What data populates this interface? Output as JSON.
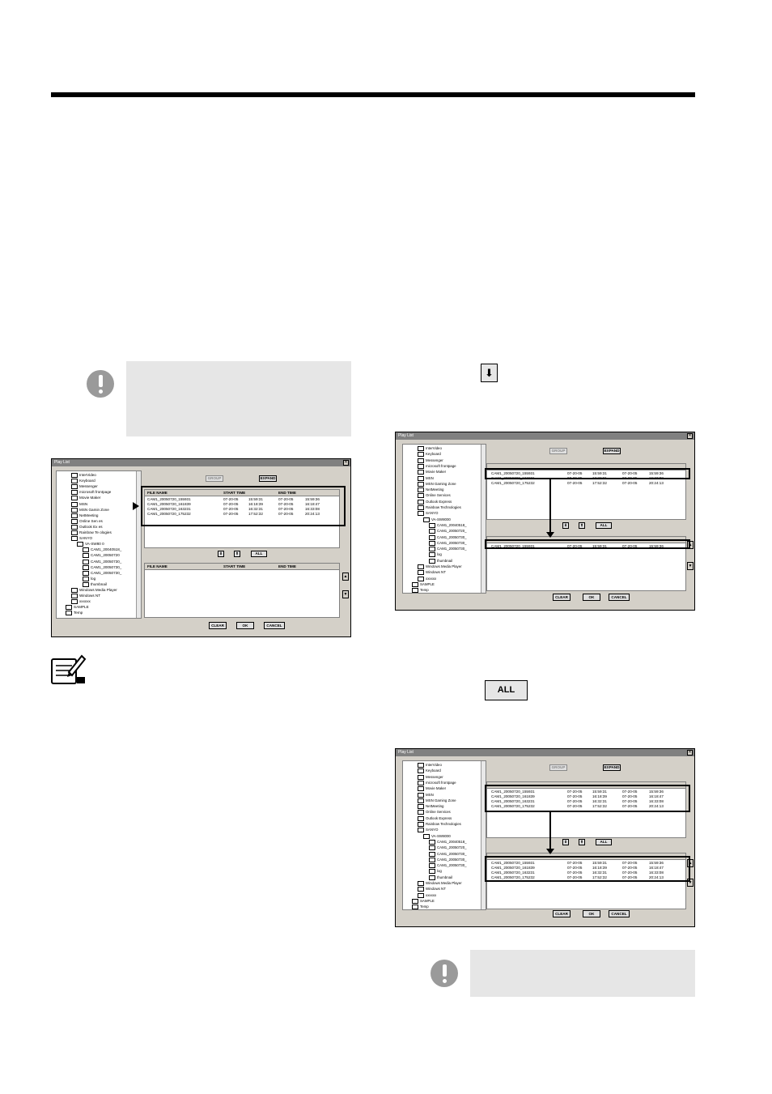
{
  "dialog": {
    "title": "Play List",
    "close_glyph": "✕",
    "group_label": "GROUP",
    "expand_label": "EXPAND",
    "down_glyph": "⬇",
    "up_glyph": "⬆",
    "all_label": "ALL",
    "clear_label": "CLEAR",
    "ok_label": "OK",
    "cancel_label": "CANCEL",
    "scroll_up_glyph": "▲",
    "scroll_down_glyph": "▼",
    "columns": [
      "FILE NAME",
      "START TIME",
      "END TIME"
    ]
  },
  "tree": {
    "items": [
      "InterVideo",
      "Keyboard",
      "Messenger",
      "microsoft frontpage",
      "Movie Maker",
      "MSN",
      "MSN Gaming Zone",
      "NetMeeting",
      "Online Services",
      "Outlook Express",
      "Rainbow Technologies",
      "SANYO",
      "VA-SW8000",
      "CAM1_20040518_",
      "CAM1_20050720_",
      "CAM1_20050730_",
      "CAM1_20050730_",
      "CAM1_20050730_",
      "log",
      "thumbnail",
      "Windows Media Player",
      "Windows NT",
      "xxxxxx",
      "SAMPLE",
      "Temp"
    ],
    "fig1_items": [
      "InterVideo",
      "Keyboard",
      "Messenger",
      "microsoft frontpage",
      "Movie Maker",
      "MSN",
      "MSN Gamin Zone",
      "NetMeeting",
      "Online Sen es",
      "Outlook Ex es",
      "Rainbow Te ologies",
      "SANYO",
      "VA-SW80 0",
      "CAM1_20040518_",
      "CAM1_20050720",
      "CAM1_20050730_",
      "CAM1_20050730_",
      "CAM1_20050730_",
      "log",
      "thumbnail",
      "Windows Media Player",
      "Windows NT",
      "xxxxxx",
      "SAMPLE",
      "Temp"
    ]
  },
  "files": [
    {
      "name": "CAM1_20050720_155931",
      "start_date": "07-20-05",
      "start_time": "15:59:31",
      "end_date": "07-20-05",
      "end_time": "15:59:36"
    },
    {
      "name": "CAM1_20050720_161839",
      "start_date": "07-20-05",
      "start_time": "16:18:39",
      "end_date": "07-20-05",
      "end_time": "16:18:47"
    },
    {
      "name": "CAM1_20050720_163231",
      "start_date": "07-20-05",
      "start_time": "16:32:31",
      "end_date": "07-20-05",
      "end_time": "16:33:08"
    },
    {
      "name": "CAM1_20050720_175232",
      "start_date": "07-20-05",
      "start_time": "17:52:32",
      "end_date": "07-20-05",
      "end_time": "20:24:13"
    }
  ],
  "inline_icons": {
    "down_glyph": "⬇",
    "all_label": "ALL"
  },
  "icons": {
    "caution": "caution-icon",
    "memo": "memo-icon"
  }
}
